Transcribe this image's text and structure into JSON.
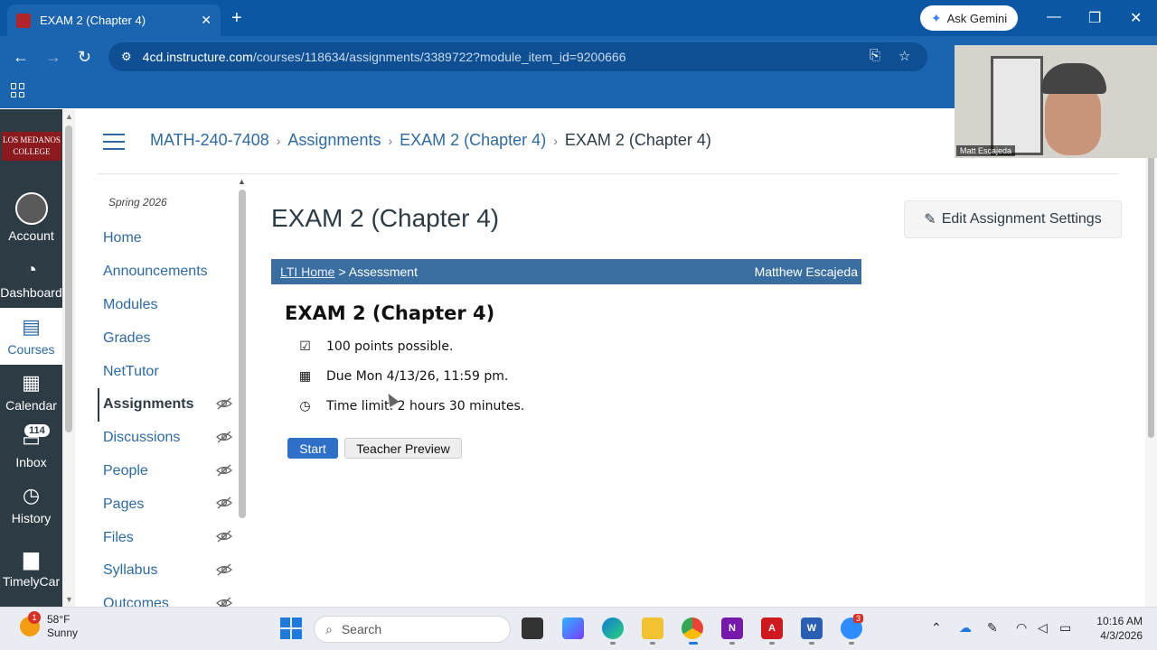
{
  "browser": {
    "tab_title": "EXAM 2 (Chapter 4)",
    "favicon_text": "LOS MEDANOS",
    "url_host": "4cd.instructure.com",
    "url_path": "/courses/118634/assignments/3389722?module_item_id=9200666",
    "gemini_label": "Ask Gemini"
  },
  "video": {
    "name": "Matt Escajeda"
  },
  "school": {
    "logo_text_1": "LOS MEDANOS",
    "logo_text_2": "COLLEGE"
  },
  "global_nav": [
    {
      "label": "Account",
      "icon": "avatar"
    },
    {
      "label": "Dashboard",
      "icon": "dashboard-icon"
    },
    {
      "label": "Courses",
      "icon": "book-icon"
    },
    {
      "label": "Calendar",
      "icon": "calendar-icon"
    },
    {
      "label": "Inbox",
      "icon": "inbox-icon",
      "badge": "114"
    },
    {
      "label": "History",
      "icon": "clock-icon"
    },
    {
      "label": "TimelyCar",
      "icon": "chat-icon"
    }
  ],
  "breadcrumb": [
    "MATH-240-7408",
    "Assignments",
    "EXAM 2 (Chapter 4)",
    "EXAM 2 (Chapter 4)"
  ],
  "term": "Spring 2026",
  "course_nav": [
    {
      "label": "Home",
      "hidden": false
    },
    {
      "label": "Announcements",
      "hidden": false
    },
    {
      "label": "Modules",
      "hidden": false
    },
    {
      "label": "Grades",
      "hidden": false
    },
    {
      "label": "NetTutor",
      "hidden": false
    },
    {
      "label": "Assignments",
      "hidden": true,
      "active": true
    },
    {
      "label": "Discussions",
      "hidden": true
    },
    {
      "label": "People",
      "hidden": true
    },
    {
      "label": "Pages",
      "hidden": true
    },
    {
      "label": "Files",
      "hidden": true
    },
    {
      "label": "Syllabus",
      "hidden": true
    },
    {
      "label": "Outcomes",
      "hidden": true
    }
  ],
  "main": {
    "title": "EXAM 2 (Chapter 4)",
    "edit_button": "Edit Assignment Settings",
    "lti_home": "LTI Home",
    "lti_sep": "> Assessment",
    "lti_user": "Matthew Escajeda",
    "exam_heading": "EXAM 2 (Chapter 4)",
    "points": "100 points possible.",
    "due": "Due Mon 4/13/26, 11:59 pm.",
    "time_limit": "Time limit: 2 hours 30 minutes.",
    "start_button": "Start",
    "preview_button": "Teacher Preview"
  },
  "taskbar": {
    "temp": "58°F",
    "condition": "Sunny",
    "weather_badge": "1",
    "search_placeholder": "Search",
    "time": "10:16 AM",
    "date": "4/3/2026",
    "zoom_badge": "3"
  },
  "colors": {
    "canvas_nav": "#2d3b45",
    "link": "#2d6aa3",
    "chrome_blue": "#1a64b0",
    "lti_bar": "#3b6ea0"
  }
}
